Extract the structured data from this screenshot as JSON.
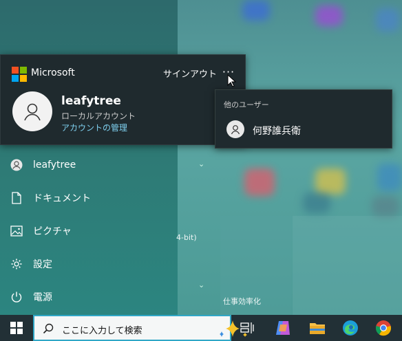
{
  "account_flyout": {
    "brand": "Microsoft",
    "signout_label": "サインアウト",
    "more_label": "···",
    "user_name": "leafytree",
    "account_type": "ローカルアカウント",
    "manage_link": "アカウントの管理"
  },
  "other_users": {
    "title": "他のユーザー",
    "users": [
      {
        "name": "何野誰兵衛",
        "icon": "user-icon"
      }
    ]
  },
  "start_nav": {
    "items": [
      {
        "label": "leafytree",
        "icon": "user-icon"
      },
      {
        "label": "ドキュメント",
        "icon": "document-icon"
      },
      {
        "label": "ピクチャ",
        "icon": "picture-icon"
      },
      {
        "label": "設定",
        "icon": "gear-icon"
      },
      {
        "label": "電源",
        "icon": "power-icon"
      }
    ]
  },
  "background_text": {
    "app_partial": "4-bit)",
    "group_label": "仕事効率化"
  },
  "taskbar": {
    "search_placeholder": "ここに入力して検索",
    "apps": [
      "task-view-icon",
      "copilot-icon",
      "file-explorer-icon",
      "edge-icon",
      "chrome-icon"
    ]
  },
  "colors": {
    "ms_red": "#f25022",
    "ms_green": "#7fba00",
    "ms_blue": "#00a4ef",
    "ms_yellow": "#ffb900",
    "link": "#7fd1f0",
    "search_border": "#2fa7c6"
  }
}
